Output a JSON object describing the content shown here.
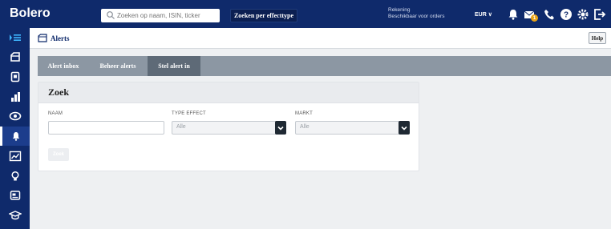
{
  "header": {
    "logo": "Bolero",
    "search_placeholder": "Zoeken op naam, ISIN, ticker",
    "advanced_search_label": "Zoeken per effecttype",
    "account_label": "Rekening",
    "account_sub": "Beschikbaar voor orders",
    "currency": "EUR ∨",
    "message_badge": "1"
  },
  "breadcrumb": {
    "title": "Alerts"
  },
  "help_label": "Help",
  "tabs": [
    {
      "label": "Alert inbox",
      "active": false
    },
    {
      "label": "Beheer alerts",
      "active": false
    },
    {
      "label": "Stel alert in",
      "active": true
    }
  ],
  "form": {
    "title": "Zoek",
    "name_label": "NAAM",
    "name_value": "",
    "type_label": "TYPE EFFECT",
    "type_value": "Alle",
    "market_label": "MARKT",
    "market_value": "Alle",
    "submit_label": "Zoek"
  },
  "sidebar": [
    "menu-toggle-icon",
    "portfolio-icon",
    "orders-icon",
    "markets-icon",
    "watchlist-icon",
    "alerts-icon",
    "analysis-icon",
    "ideas-icon",
    "news-icon",
    "learn-icon"
  ],
  "colors": {
    "brand": "#0f2a6b",
    "tab_bar": "#8c97a3",
    "tab_active": "#5e6a77"
  }
}
